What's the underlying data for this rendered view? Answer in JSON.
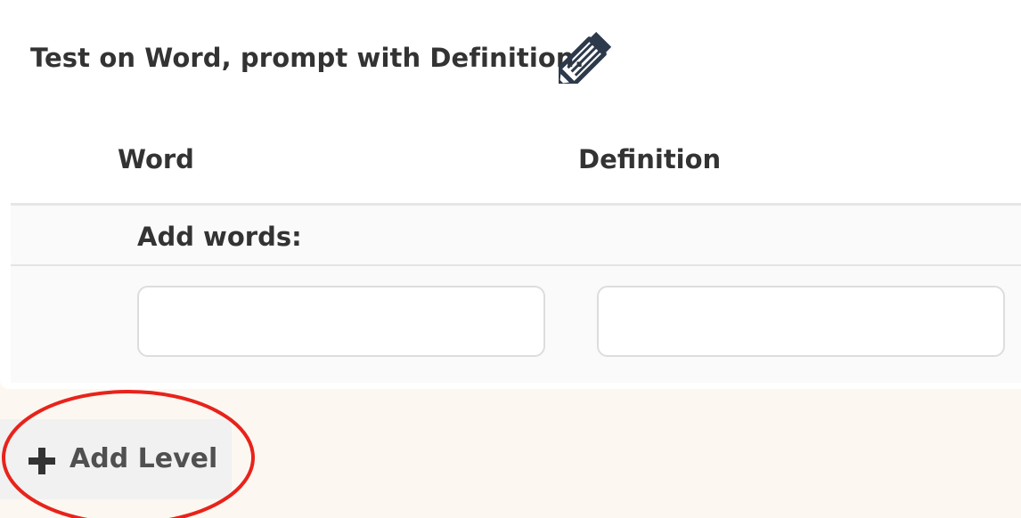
{
  "prompt": {
    "title": "Test on Word, prompt with Definition.",
    "edit_icon": "pencil-icon"
  },
  "table": {
    "columns": [
      "Word",
      "Definition"
    ],
    "add_words_label": "Add words:",
    "inputs": [
      {
        "column": "Word",
        "value": "",
        "placeholder": ""
      },
      {
        "column": "Definition",
        "value": "",
        "placeholder": ""
      }
    ]
  },
  "actions": {
    "add_level_label": "Add Level",
    "add_level_icon": "plus-icon"
  },
  "annotation": {
    "highlight_shape": "ellipse",
    "highlight_color": "#e8231b"
  },
  "colors": {
    "page_background": "#fcf8f1",
    "card_background": "#ffffff",
    "text": "#333333",
    "icon": "#2d3a4c"
  }
}
